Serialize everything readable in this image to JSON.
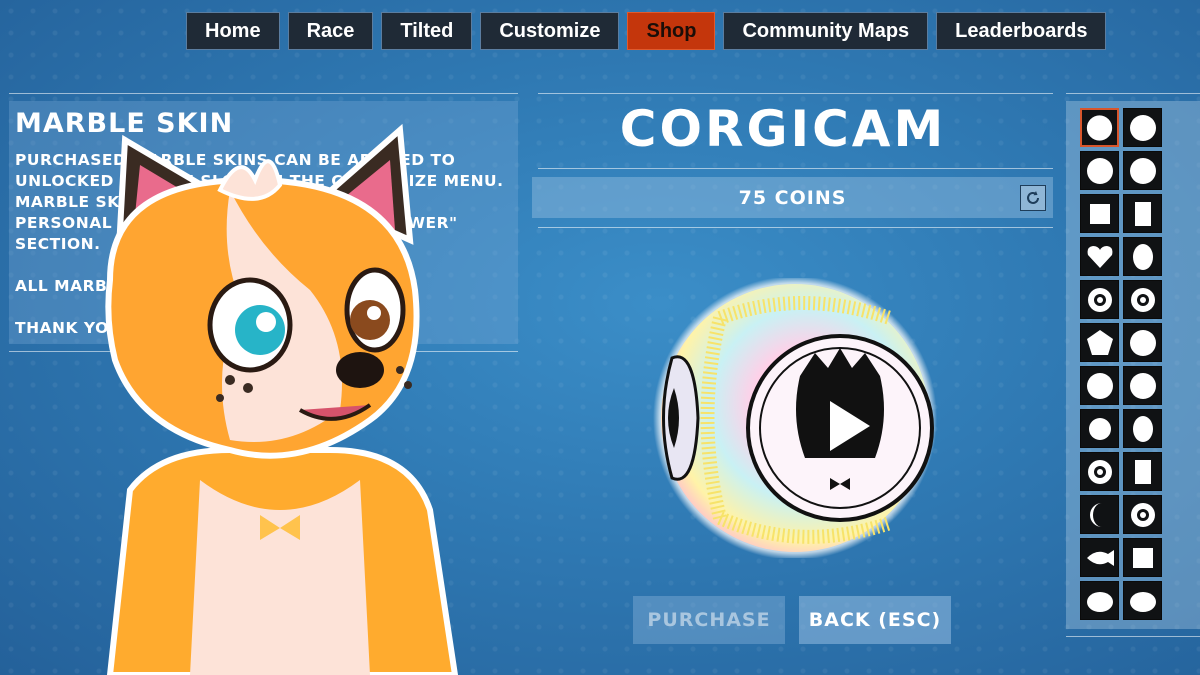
{
  "nav": {
    "items": [
      {
        "label": "Home",
        "active": false
      },
      {
        "label": "Race",
        "active": false
      },
      {
        "label": "Tilted",
        "active": false
      },
      {
        "label": "Customize",
        "active": false
      },
      {
        "label": "Shop",
        "active": true
      },
      {
        "label": "Community Maps",
        "active": false
      },
      {
        "label": "Leaderboards",
        "active": false
      }
    ]
  },
  "description": {
    "title": "MARBLE SKIN",
    "body": "PURCHASED MARBLE SKINS CAN BE APPLIED TO\nUNLOCKED MARBLE SLOTS IN THE CUSTOMIZE MENU.\nMARBLE SKINS CAN BE APPLIED TO YOUR\nPERSONAL CHANNEL MARBLES IN THE \"VIEWER\"\nSECTION.\n\nALL MARBLE SKINS ARE COSMETIC.\n\nTHANK YOU FOR SUPPORTING THE STREAM."
  },
  "item": {
    "name": "CORGICAM",
    "price": "75 COINS"
  },
  "actions": {
    "purchase": "PURCHASE",
    "back": "BACK (ESC)"
  },
  "icons": {
    "refresh": "refresh-icon",
    "play": "play-icon"
  },
  "colors": {
    "nav_bg": "#1f2a36",
    "nav_active": "#c4360c",
    "selection": "#d8562c"
  },
  "skins": [
    "circle",
    "circle",
    "circle-rough",
    "panda-face",
    "square",
    "tall-box",
    "heart",
    "egg",
    "flower-circle",
    "gear-circle",
    "pentagon-shape",
    "soccer-ball",
    "blob",
    "pumpkin",
    "circle-small",
    "alien-head",
    "eye-ring",
    "cup",
    "half-moon",
    "dotted-sphere",
    "fish",
    "square-block",
    "turtle",
    "bird"
  ]
}
